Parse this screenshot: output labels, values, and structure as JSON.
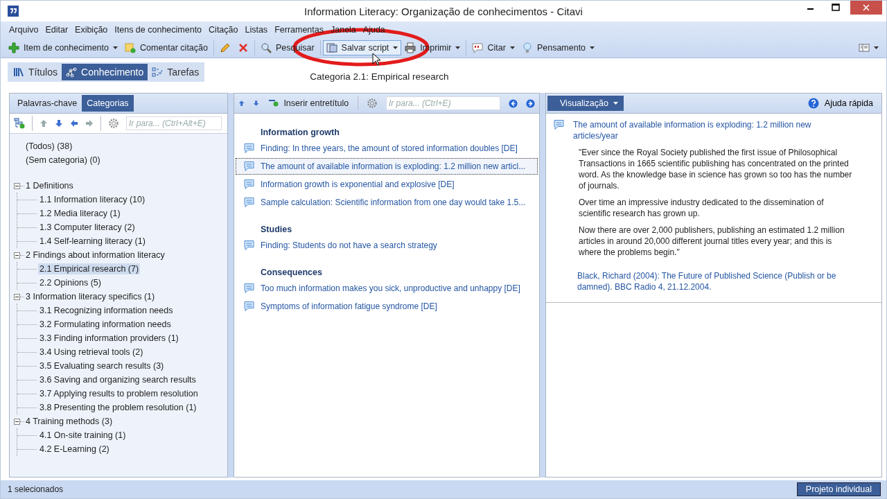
{
  "window": {
    "title": "Information Literacy: Organização de conhecimentos - Citavi"
  },
  "menu": [
    "Arquivo",
    "Editar",
    "Exibição",
    "Itens de conhecimento",
    "Citação",
    "Listas",
    "Ferramentas",
    "Janela",
    "Ajuda"
  ],
  "toolbar": [
    [
      {
        "kind": "plus",
        "label": "Item de conhecimento",
        "dropdown": true
      },
      {
        "kind": "comment",
        "label": "Comentar citação",
        "dropdown": false
      }
    ],
    [
      {
        "kind": "pencil",
        "dropdown": false
      },
      {
        "kind": "delete",
        "dropdown": false
      }
    ],
    [
      {
        "kind": "search",
        "label": "Pesquisar",
        "dropdown": false
      }
    ],
    [
      {
        "kind": "script",
        "label": "Salvar script",
        "dropdown": true
      },
      {
        "kind": "print",
        "label": "Imprimir",
        "dropdown": true
      }
    ],
    [
      {
        "kind": "quote",
        "label": "Citar",
        "dropdown": true
      },
      {
        "kind": "bulb",
        "label": "Pensamento",
        "dropdown": true
      }
    ]
  ],
  "views": [
    {
      "kind": "titles",
      "label": "Títulos",
      "selected": false
    },
    {
      "kind": "knowledge",
      "label": "Conhecimento",
      "selected": true
    },
    {
      "kind": "tasks",
      "label": "Tarefas",
      "selected": false
    }
  ],
  "breadcrumb": "Categoria 2.1: Empirical research",
  "left_panel": {
    "tabs": [
      {
        "label": "Palavras-chave",
        "selected": false
      },
      {
        "label": "Categorias",
        "selected": true
      }
    ],
    "search": {
      "placeholder": "Ir para... (Ctrl+Alt+E)"
    },
    "special_items": [
      "(Todos) (38)",
      "(Sem categoria) (0)"
    ],
    "tree": [
      {
        "label": "1 Definitions",
        "expanded": true,
        "selected": false,
        "children": [
          {
            "label": "1.1 Information literacy (10)",
            "selected": false
          },
          {
            "label": "1.2 Media literacy (1)",
            "selected": false
          },
          {
            "label": "1.3 Computer literacy (2)",
            "selected": false
          },
          {
            "label": "1.4 Self-learning literacy (1)",
            "selected": false
          }
        ]
      },
      {
        "label": "2 Findings about information literacy",
        "expanded": true,
        "selected": false,
        "children": [
          {
            "label": "2.1 Empirical research (7)",
            "selected": true
          },
          {
            "label": "2.2 Opinions (5)",
            "selected": false
          }
        ]
      },
      {
        "label": "3 Information literacy specifics (1)",
        "expanded": true,
        "selected": false,
        "children": [
          {
            "label": "3.1 Recognizing information needs",
            "selected": false
          },
          {
            "label": "3.2 Formulating information needs",
            "selected": false
          },
          {
            "label": "3.3 Finding information providers (1)",
            "selected": false
          },
          {
            "label": "3.4 Using retrieval tools (2)",
            "selected": false
          },
          {
            "label": "3.5 Evaluating search results (3)",
            "selected": false
          },
          {
            "label": "3.6 Saving and organizing search results",
            "selected": false
          },
          {
            "label": "3.7 Applying results to problem resolution",
            "selected": false
          },
          {
            "label": "3.8 Presenting the problem resolution (1)",
            "selected": false
          }
        ]
      },
      {
        "label": "4 Training methods (3)",
        "expanded": true,
        "selected": false,
        "children": [
          {
            "label": "4.1 On-site training (1)",
            "selected": false
          },
          {
            "label": "4.2 E-Learning (2)",
            "selected": false
          }
        ]
      }
    ]
  },
  "middle_panel": {
    "insert_label": "Inserir entretítulo",
    "search": {
      "placeholder": "Ir para... (Ctrl+E)"
    },
    "groups": [
      {
        "heading": "Information growth",
        "items": [
          {
            "text": "Finding: In three years, the amount of stored information doubles [DE]",
            "selected": false
          },
          {
            "text": "The amount of available information is exploding: 1.2 million new articl...",
            "selected": true
          },
          {
            "text": "Information growth is exponential and explosive [DE]",
            "selected": false
          },
          {
            "text": "Sample calculation: Scientific information from one day would take 1.5...",
            "selected": false
          }
        ]
      },
      {
        "heading": "Studies",
        "items": [
          {
            "text": "Finding: Students do not have a search strategy",
            "selected": false
          }
        ]
      },
      {
        "heading": "Consequences",
        "items": [
          {
            "text": "Too much information makes you sick, unproductive and unhappy [DE]",
            "selected": false
          },
          {
            "text": "Symptoms of information fatigue syndrome [DE]",
            "selected": false
          }
        ]
      }
    ]
  },
  "right_panel": {
    "view_button": "Visualização",
    "help": "Ajuda rápida",
    "title": "The amount of available information is exploding: 1.2 million new articles/year",
    "paragraphs": [
      "\"Ever since the Royal Society published the first issue of Philosophical Transactions in 1665 scientific publishing has concentrated on the printed word. As the knowledge base in science has grown so too has the number of journals.",
      "Over time an impressive industry dedicated to the dissemination of scientific research has grown up.",
      "Now there are over 2,000 publishers, publishing an estimated 1.2 million articles in around 20,000 different journal titles every year; and this is where the problems begin.\""
    ],
    "citation": "Black, Richard (2004): The Future of Published Science (Publish or be damned). BBC Radio 4, 21.12.2004."
  },
  "status_bar": {
    "text": "1 selecionados",
    "project": "Projeto individual"
  }
}
